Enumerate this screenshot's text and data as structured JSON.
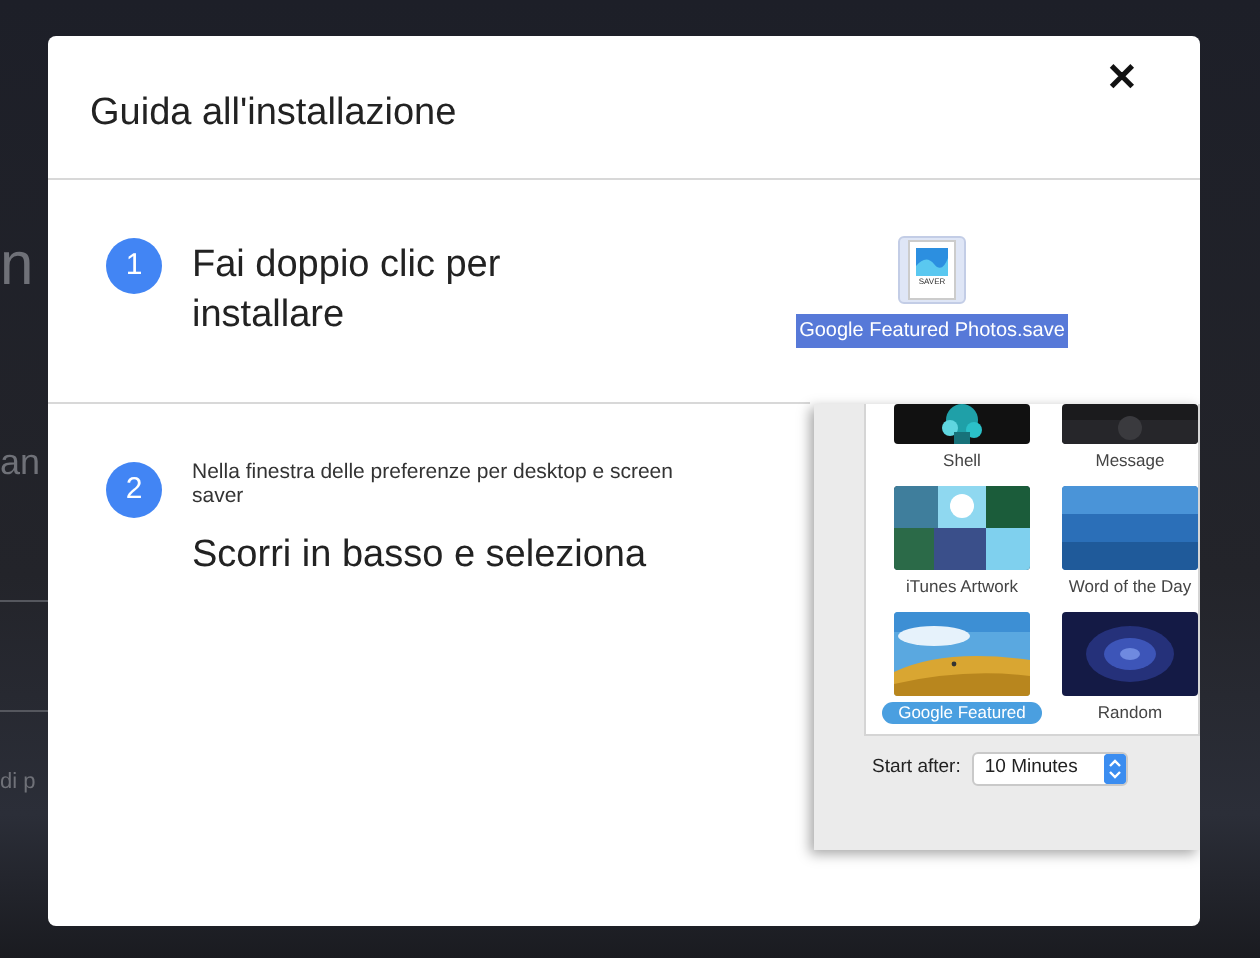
{
  "background_fragments": [
    "n",
    "an",
    "di p"
  ],
  "dialog": {
    "title": "Guida all'installazione",
    "close": "✕"
  },
  "steps": [
    {
      "number": "1",
      "title": "Fai doppio clic per installare",
      "file": {
        "icon_label": "SAVER",
        "name": "Google Featured Photos.save",
        "selected": true
      }
    },
    {
      "number": "2",
      "note": "Nella finestra delle preferenze per desktop e screen saver",
      "title": "Scorri in basso e seleziona"
    }
  ],
  "screensaver_panel": {
    "items": [
      {
        "label": "Shell",
        "kind": "shell",
        "selected": false
      },
      {
        "label": "Message",
        "kind": "message",
        "selected": false
      },
      {
        "label": "iTunes Artwork",
        "kind": "artwork",
        "selected": false
      },
      {
        "label": "Word of the Day",
        "kind": "words",
        "selected": false
      },
      {
        "label": "Google Featured",
        "kind": "landscape",
        "selected": true
      },
      {
        "label": "Random",
        "kind": "swirl",
        "selected": false
      }
    ],
    "start_after_label": "Start after:",
    "start_after_value": "10 Minutes"
  }
}
